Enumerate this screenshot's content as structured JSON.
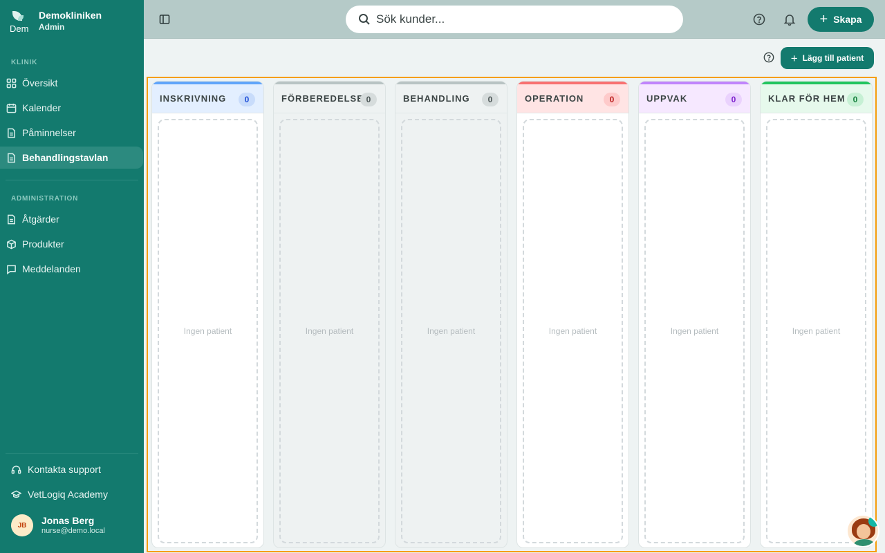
{
  "brand": {
    "name": "Demokliniken",
    "role": "Admin",
    "mini": "Dem"
  },
  "sidebar": {
    "section_klinik": "KLINIK",
    "klinik_items": [
      {
        "label": "Översikt",
        "icon": "grid-icon"
      },
      {
        "label": "Kalender",
        "icon": "calendar-icon"
      },
      {
        "label": "Påminnelser",
        "icon": "document-icon"
      },
      {
        "label": "Behandlingstavlan",
        "icon": "document-icon",
        "active": true
      }
    ],
    "section_admin": "ADMINISTRATION",
    "admin_items": [
      {
        "label": "Åtgärder",
        "icon": "document-icon"
      },
      {
        "label": "Produkter",
        "icon": "box-icon"
      },
      {
        "label": "Meddelanden",
        "icon": "message-icon"
      }
    ],
    "footer": {
      "support": "Kontakta support",
      "academy": "VetLogiq Academy"
    },
    "user": {
      "initials": "JB",
      "name": "Jonas Berg",
      "email": "nurse@demo.local"
    }
  },
  "topbar": {
    "search_placeholder": "Sök kunder...",
    "create_label": "Skapa"
  },
  "actions": {
    "add_patient_label": "Lägg till patient"
  },
  "board": {
    "columns": [
      {
        "title": "INSKRIVNING",
        "count": "0",
        "empty": "Ingen patient",
        "accent": "#60a5fa",
        "head_bg": "#e3efff",
        "badge_bg": "#c8dcfb",
        "badge_fg": "#1d4ed8",
        "body_bg": "#ffffff"
      },
      {
        "title": "FÖRBEREDELSE",
        "count": "0",
        "empty": "Ingen patient",
        "accent": "#b8c3c3",
        "head_bg": "#eef2f2",
        "badge_bg": "#d6dcdc",
        "badge_fg": "#4b5555",
        "body_bg": "#eef2f2"
      },
      {
        "title": "BEHANDLING",
        "count": "0",
        "empty": "Ingen patient",
        "accent": "#b8c3c3",
        "head_bg": "#eef2f2",
        "badge_bg": "#d6dcdc",
        "badge_fg": "#4b5555",
        "body_bg": "#eef2f2"
      },
      {
        "title": "OPERATION",
        "count": "0",
        "empty": "Ingen patient",
        "accent": "#f87171",
        "head_bg": "#ffe4e4",
        "badge_bg": "#fecaca",
        "badge_fg": "#b91c1c",
        "body_bg": "#ffffff"
      },
      {
        "title": "UPPVAK",
        "count": "0",
        "empty": "Ingen patient",
        "accent": "#c084fc",
        "head_bg": "#f6e8ff",
        "badge_bg": "#ead2fd",
        "badge_fg": "#7e22ce",
        "body_bg": "#ffffff"
      },
      {
        "title": "KLAR FÖR HEM",
        "count": "0",
        "empty": "Ingen patient",
        "accent": "#22c55e",
        "head_bg": "#e6f9ec",
        "badge_bg": "#c6f0d4",
        "badge_fg": "#15803d",
        "body_bg": "#ffffff"
      }
    ]
  }
}
